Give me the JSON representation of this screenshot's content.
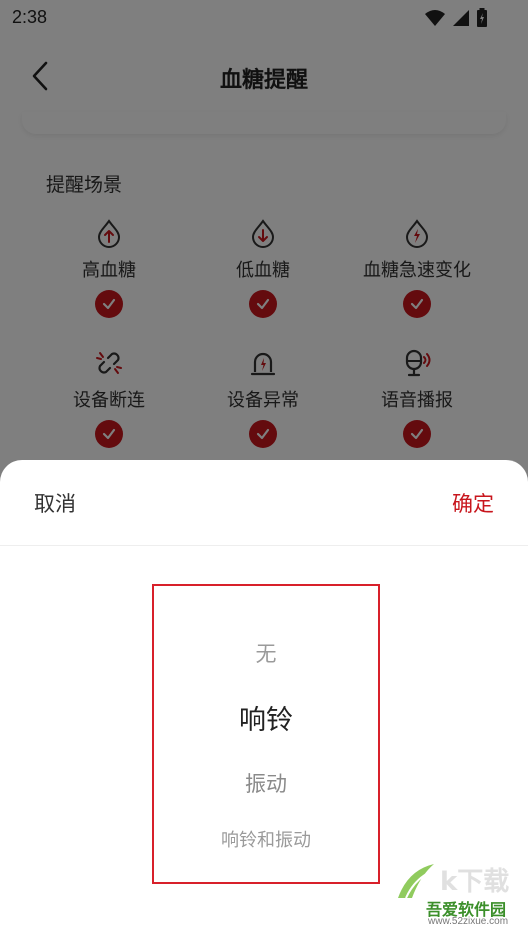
{
  "status_bar": {
    "time": "2:38"
  },
  "header": {
    "title": "血糖提醒"
  },
  "section": {
    "title": "提醒场景"
  },
  "scenes": [
    {
      "label": "高血糖",
      "icon": "drop-up-arrow-icon",
      "checked": true
    },
    {
      "label": "低血糖",
      "icon": "drop-down-arrow-icon",
      "checked": true
    },
    {
      "label": "血糖急速变化",
      "icon": "drop-lightning-icon",
      "checked": true
    },
    {
      "label": "设备断连",
      "icon": "broken-link-icon",
      "checked": true
    },
    {
      "label": "设备异常",
      "icon": "alarm-light-icon",
      "checked": true
    },
    {
      "label": "语音播报",
      "icon": "microphone-sound-icon",
      "checked": true
    }
  ],
  "sheet": {
    "cancel_label": "取消",
    "confirm_label": "确定",
    "options": [
      "无",
      "响铃",
      "振动",
      "响铃和振动"
    ],
    "selected": "响铃"
  },
  "watermark": {
    "brand": "吾爱软件园",
    "url": "www.52zixue.com"
  },
  "colors": {
    "accent": "#c8161d",
    "highlight_border": "#d8202a"
  }
}
